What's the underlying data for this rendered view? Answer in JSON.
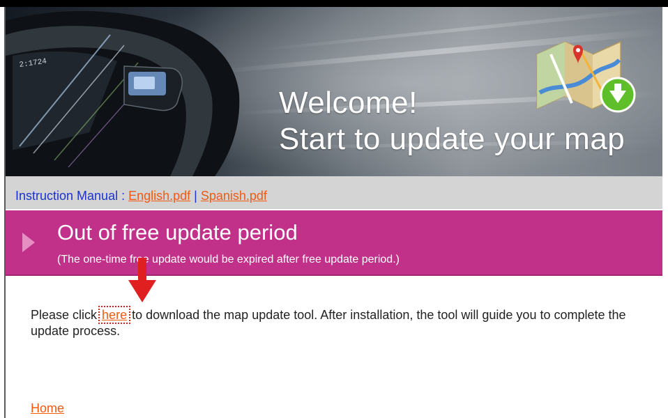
{
  "banner": {
    "line1": "Welcome!",
    "line2": "Start to update your map",
    "dashboard_readout": "2:1724"
  },
  "instructions": {
    "label": "Instruction Manual : ",
    "english_link": "English.pdf",
    "separator": " | ",
    "spanish_link": "Spanish.pdf"
  },
  "status": {
    "title": "Out of free update period",
    "subtitle": "(The one-time free update would be expired after free update period.)"
  },
  "body": {
    "prefix": "Please click ",
    "link": "here",
    "suffix": " to download the map update tool. After installation, the tool will guide you to complete the update process."
  },
  "footer": {
    "home_link": "Home"
  },
  "colors": {
    "link": "#f05a13",
    "instruction_text": "#1b33c8",
    "status_banner": "#c1318a",
    "instruction_bar": "#d4d4d4",
    "annotation_arrow": "#e02020",
    "download_badge": "#5fbf2b"
  },
  "icons": {
    "banner_icon": "map-download-icon",
    "banner_arrow": "play-arrow-icon",
    "annotation": "red-down-arrow-icon"
  }
}
